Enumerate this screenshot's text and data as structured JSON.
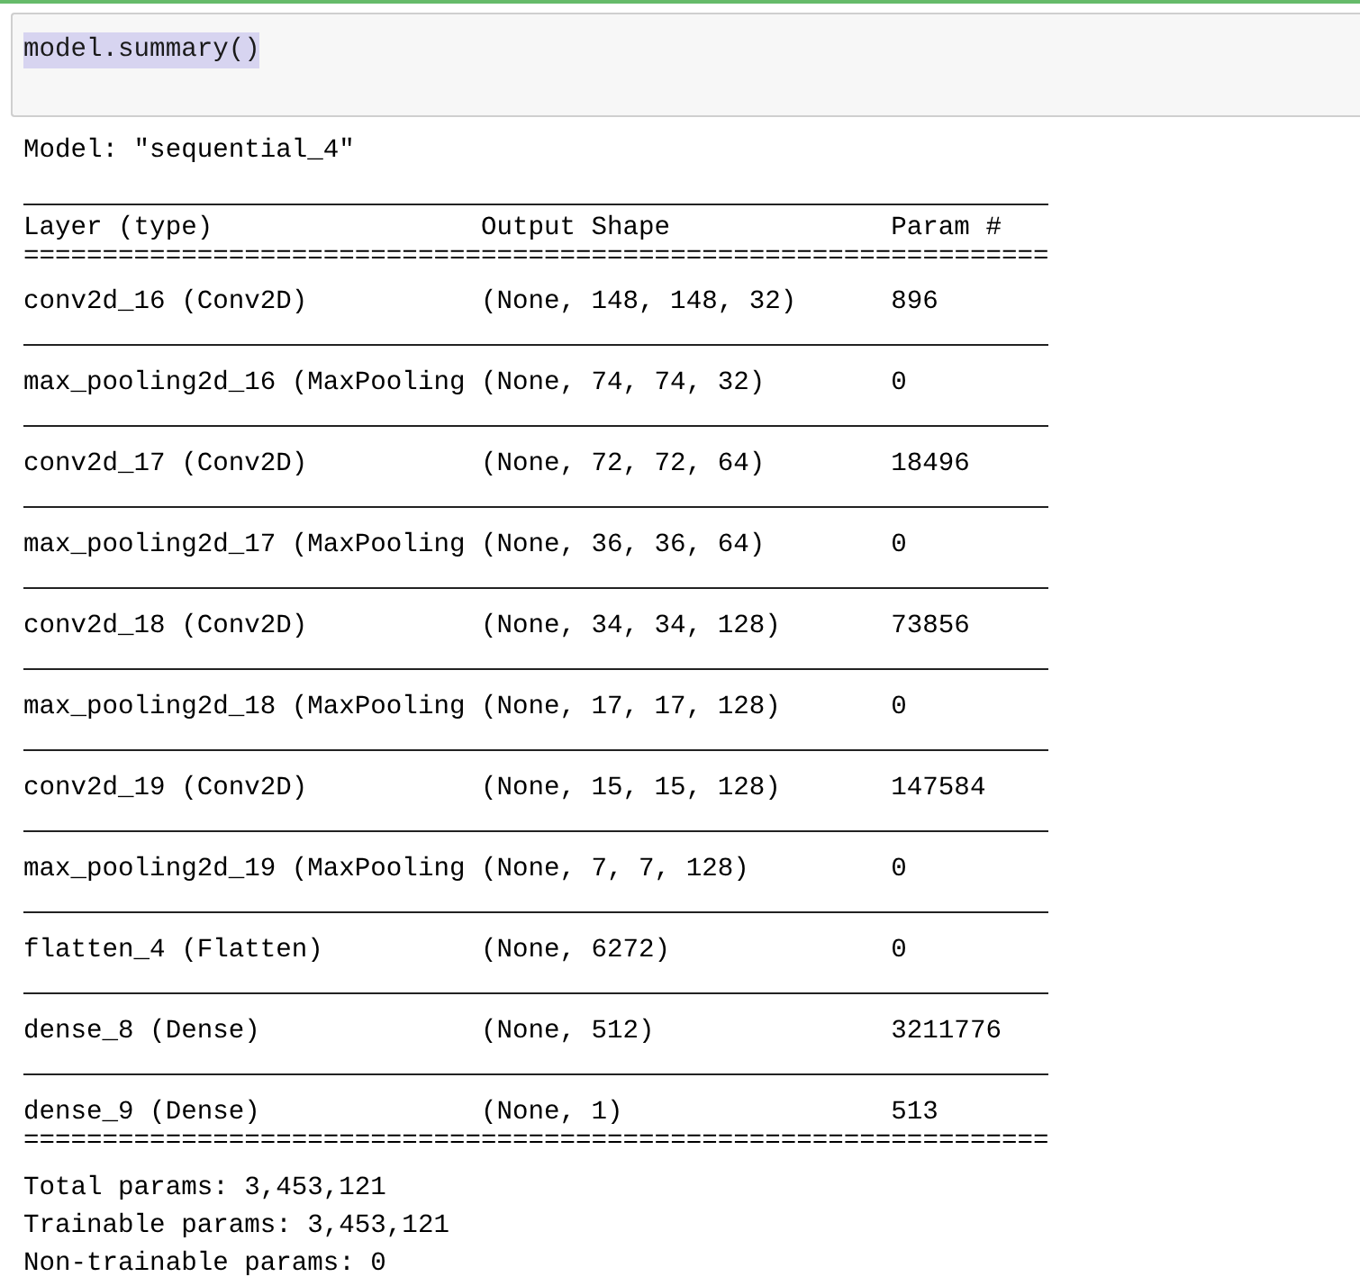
{
  "input_cell": {
    "code": "model.summary()",
    "selected": true
  },
  "output": {
    "model_line": "Model: \"sequential_4\"",
    "columns": [
      "Layer (type)",
      "Output Shape",
      "Param #"
    ],
    "header_rule": "=================================================================",
    "rows": [
      {
        "layer": "conv2d_16 (Conv2D)",
        "shape": "(None, 148, 148, 32)",
        "params": "896"
      },
      {
        "layer": "max_pooling2d_16 (MaxPooling",
        "shape": "(None, 74, 74, 32)",
        "params": "0"
      },
      {
        "layer": "conv2d_17 (Conv2D)",
        "shape": "(None, 72, 72, 64)",
        "params": "18496"
      },
      {
        "layer": "max_pooling2d_17 (MaxPooling",
        "shape": "(None, 36, 36, 64)",
        "params": "0"
      },
      {
        "layer": "conv2d_18 (Conv2D)",
        "shape": "(None, 34, 34, 128)",
        "params": "73856"
      },
      {
        "layer": "max_pooling2d_18 (MaxPooling",
        "shape": "(None, 17, 17, 128)",
        "params": "0"
      },
      {
        "layer": "conv2d_19 (Conv2D)",
        "shape": "(None, 15, 15, 128)",
        "params": "147584"
      },
      {
        "layer": "max_pooling2d_19 (MaxPooling",
        "shape": "(None, 7, 7, 128)",
        "params": "0"
      },
      {
        "layer": "flatten_4 (Flatten)",
        "shape": "(None, 6272)",
        "params": "0"
      },
      {
        "layer": "dense_8 (Dense)",
        "shape": "(None, 512)",
        "params": "3211776"
      },
      {
        "layer": "dense_9 (Dense)",
        "shape": "(None, 1)",
        "params": "513"
      }
    ],
    "footer_rule": "=================================================================",
    "totals": [
      "Total params: 3,453,121",
      "Trainable params: 3,453,121",
      "Non-trainable params: 0"
    ]
  }
}
